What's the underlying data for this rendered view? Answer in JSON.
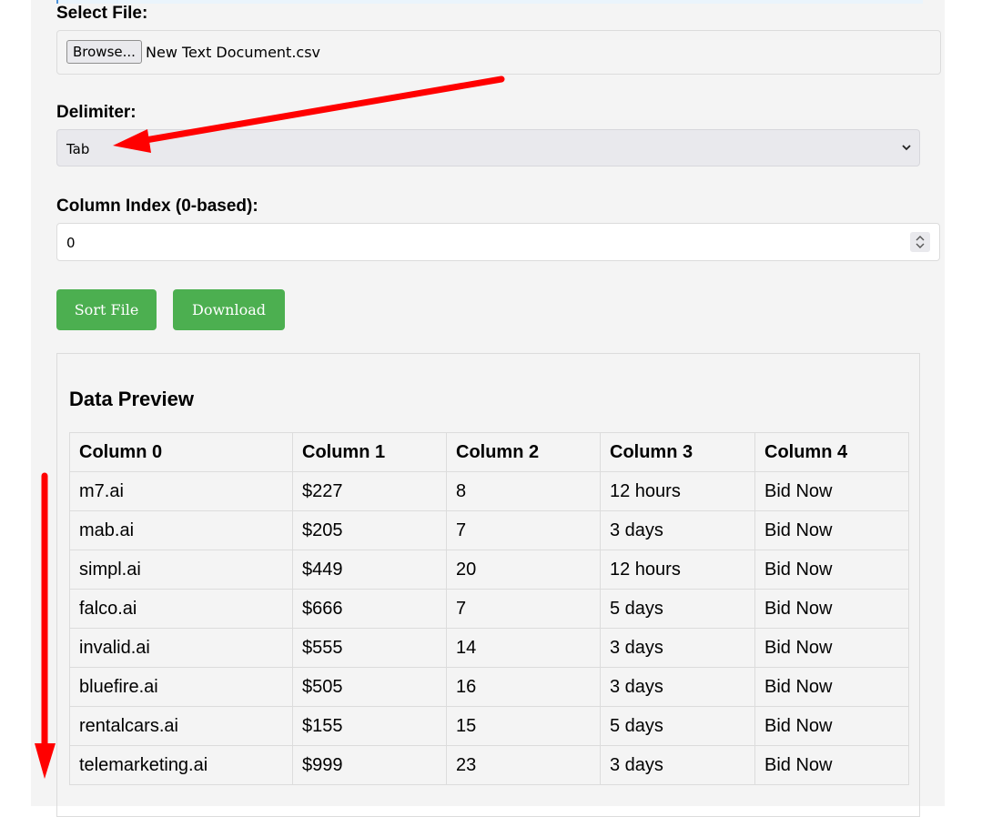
{
  "form": {
    "select_file_label": "Select File:",
    "browse_label": "Browse...",
    "file_name": "New Text Document.csv",
    "delimiter_label": "Delimiter:",
    "delimiter_value": "Tab",
    "column_index_label": "Column Index (0-based):",
    "column_index_value": "0"
  },
  "buttons": {
    "sort_label": "Sort File",
    "download_label": "Download"
  },
  "preview": {
    "title": "Data Preview",
    "headers": [
      "Column 0",
      "Column 1",
      "Column 2",
      "Column 3",
      "Column 4"
    ],
    "rows": [
      [
        "m7.ai",
        "$227",
        "8",
        "12 hours",
        "Bid Now"
      ],
      [
        "mab.ai",
        "$205",
        "7",
        "3 days",
        "Bid Now"
      ],
      [
        "simpl.ai",
        "$449",
        "20",
        "12 hours",
        "Bid Now"
      ],
      [
        "falco.ai",
        "$666",
        "7",
        "5 days",
        "Bid Now"
      ],
      [
        "invalid.ai",
        "$555",
        "14",
        "3 days",
        "Bid Now"
      ],
      [
        "bluefire.ai",
        "$505",
        "16",
        "3 days",
        "Bid Now"
      ],
      [
        "rentalcars.ai",
        "$155",
        "15",
        "5 days",
        "Bid Now"
      ],
      [
        "telemarketing.ai",
        "$999",
        "23",
        "3 days",
        "Bid Now"
      ]
    ]
  },
  "colors": {
    "button_green": "#4caf50",
    "annotation_red": "#ff0000"
  }
}
